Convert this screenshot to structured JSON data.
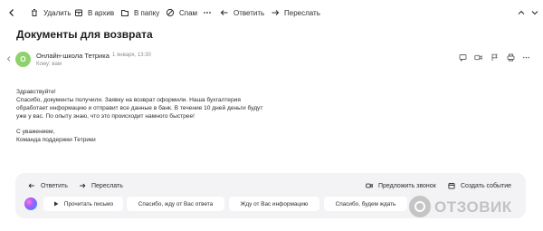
{
  "toolbar": {
    "delete": "Удалить",
    "archive": "В архив",
    "to_folder": "В папку",
    "spam": "Спам",
    "reply": "Ответить",
    "forward": "Переслать"
  },
  "email": {
    "subject": "Документы для возврата",
    "sender_initial": "O",
    "sender_name": "Онлайн-школа Тетрика",
    "date": "1 января, 13:30",
    "to": "Кому: вам",
    "body": {
      "greeting": "Здравствуйте!",
      "line1": "Спасибо, документы получили. Заявку на возврат оформили. Наша бухгалтерия",
      "line2": "обработает информацию и отправит все данные в банк. В течение 10 дней деньги будут",
      "line3": "уже у вас. По опыту знаю, что это происходит намного быстрее!",
      "signoff": "С уважением,",
      "signature": "Команда поддержки Тетрики"
    }
  },
  "panel": {
    "reply": "Ответить",
    "forward": "Переслать",
    "suggest_call": "Предложить звонок",
    "create_event": "Создать событие",
    "chips": [
      "Прочитать письмо",
      "Спасибо, жду от Вас ответа",
      "Жду от Вас информацию",
      "Спасибо, будем ждать"
    ]
  },
  "watermark": "ОТЗОВИК",
  "colors": {
    "avatar": "#8fd16b",
    "panel_bg": "#f3f3f5",
    "text": "#2c2d2e",
    "muted": "#8c8f96"
  }
}
